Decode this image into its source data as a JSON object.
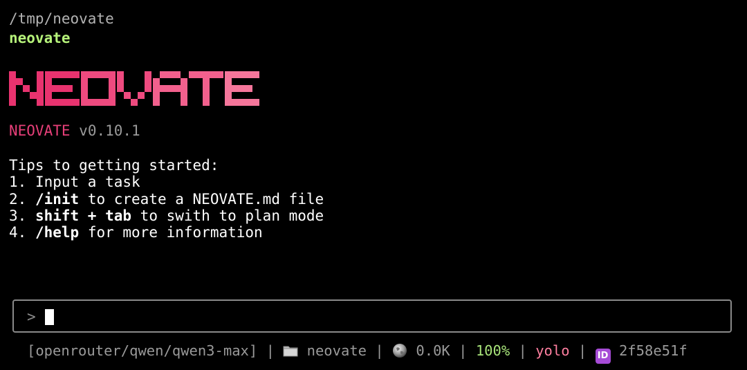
{
  "header": {
    "cwd": "/tmp/neovate",
    "project": "neovate"
  },
  "logo": {
    "text": "NEOVATE",
    "colors": [
      "#e8336f",
      "#ee4a7f",
      "#f2608d",
      "#f5769b"
    ]
  },
  "version": {
    "brand": "NEOVATE",
    "number": "v0.10.1"
  },
  "tips": {
    "title": "Tips to getting started:",
    "items": [
      {
        "num": "1.",
        "bold": "",
        "rest": " Input a task"
      },
      {
        "num": "2.",
        "bold": "/init",
        "rest": " to create a NEOVATE.md file"
      },
      {
        "num": "3.",
        "bold": "shift + tab",
        "rest": " to swith to plan mode"
      },
      {
        "num": "4.",
        "bold": "/help",
        "rest": " for more information"
      }
    ]
  },
  "input": {
    "prompt": ">",
    "value": ""
  },
  "status_bar": {
    "model": "[openrouter/qwen/qwen3-max]",
    "separator": "|",
    "folder_icon": "folder-icon",
    "folder": "neovate",
    "globe_icon": "globe-icon",
    "tokens": "0.0K",
    "context": "100%",
    "mode": "yolo",
    "id_icon": "id-icon",
    "id_icon_label": "ID",
    "session_id": "2f58e51f"
  },
  "colors": {
    "background": "#000000",
    "brand": "#e73f79",
    "green": "#b6f37a",
    "pink": "#ff7fa0",
    "muted": "#9a9a9a"
  }
}
